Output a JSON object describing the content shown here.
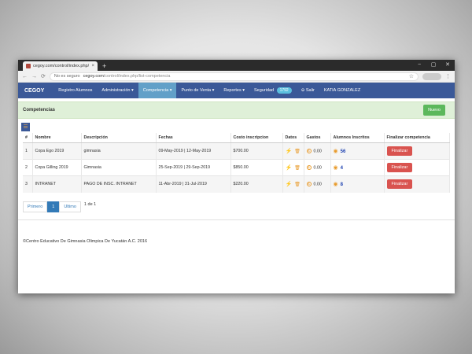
{
  "browser": {
    "tab_title": "cegoy.com/control/index.php/lis",
    "tab_close": "×",
    "new_tab": "+",
    "back_glyph": "←",
    "forward_glyph": "→",
    "reload_glyph": "⟳",
    "security_label": "No es seguro",
    "url_host": "cegoy.com",
    "url_path": "/control/index.php/list-competencia",
    "star_glyph": "☆",
    "menu_glyph": "⋮",
    "window_controls": [
      "−",
      "▢",
      "✕"
    ]
  },
  "nav": {
    "brand": "CEGOY",
    "items": [
      {
        "label": "Registro Alumnos"
      },
      {
        "label": "Administración ▾"
      },
      {
        "label": "Competencia ▾"
      },
      {
        "label": "Punto de Venta ▾"
      },
      {
        "label": "Reportes ▾"
      },
      {
        "label": "Seguridad"
      }
    ],
    "security_badge": "1792",
    "logout": "⊖ Salir",
    "user": "KATIA GONZALEZ"
  },
  "panel": {
    "title": "Competencias",
    "new_button": "Nuevo",
    "rss_glyph": "☰"
  },
  "table": {
    "headers": [
      "#",
      "Nombre",
      "Descripción",
      "Fechas",
      "Costo inscripcion",
      "Datos",
      "Gastos",
      "Alumnos Inscritos",
      "Finalizar competencia"
    ],
    "rows": [
      {
        "num": "1",
        "nombre": "Copa Ego 2019",
        "descripcion": "gimnasia",
        "fechas": "09-May-2019 | 12-May-2019",
        "costo": "$700.00",
        "gastos": "0.00",
        "alumnos": "56",
        "finalizar": "Finalizar"
      },
      {
        "num": "2",
        "nombre": "Copa Gilling 2019",
        "descripcion": "Gimnasia",
        "fechas": "25-Sep-2019 | 29-Sep-2019",
        "costo": "$850.00",
        "gastos": "0.00",
        "alumnos": "4",
        "finalizar": "Finalizar"
      },
      {
        "num": "3",
        "nombre": "INTRANET",
        "descripcion": "PAGO DE INSC. INTRANET",
        "fechas": "11-Abr-2019 | 31-Jul-2019",
        "costo": "$220.00",
        "gastos": "0.00",
        "alumnos": "8",
        "finalizar": "Finalizar"
      }
    ],
    "icons": {
      "bolt": "⚡",
      "trash": "🗑",
      "coin": "$",
      "eye": "◉"
    }
  },
  "pager": {
    "first": "Primero",
    "current": "1",
    "last": "Ultimo",
    "info": "1 de 1"
  },
  "footer": {
    "text": "©Centro Educativo De Gimnasia Olimpica De Yucatán A.C. 2016"
  },
  "colors": {
    "navbar": "#3b5998",
    "active_nav": "#62a0c8",
    "panel_bg": "#dff0d8",
    "success": "#5cb85c",
    "danger": "#d9534f"
  }
}
